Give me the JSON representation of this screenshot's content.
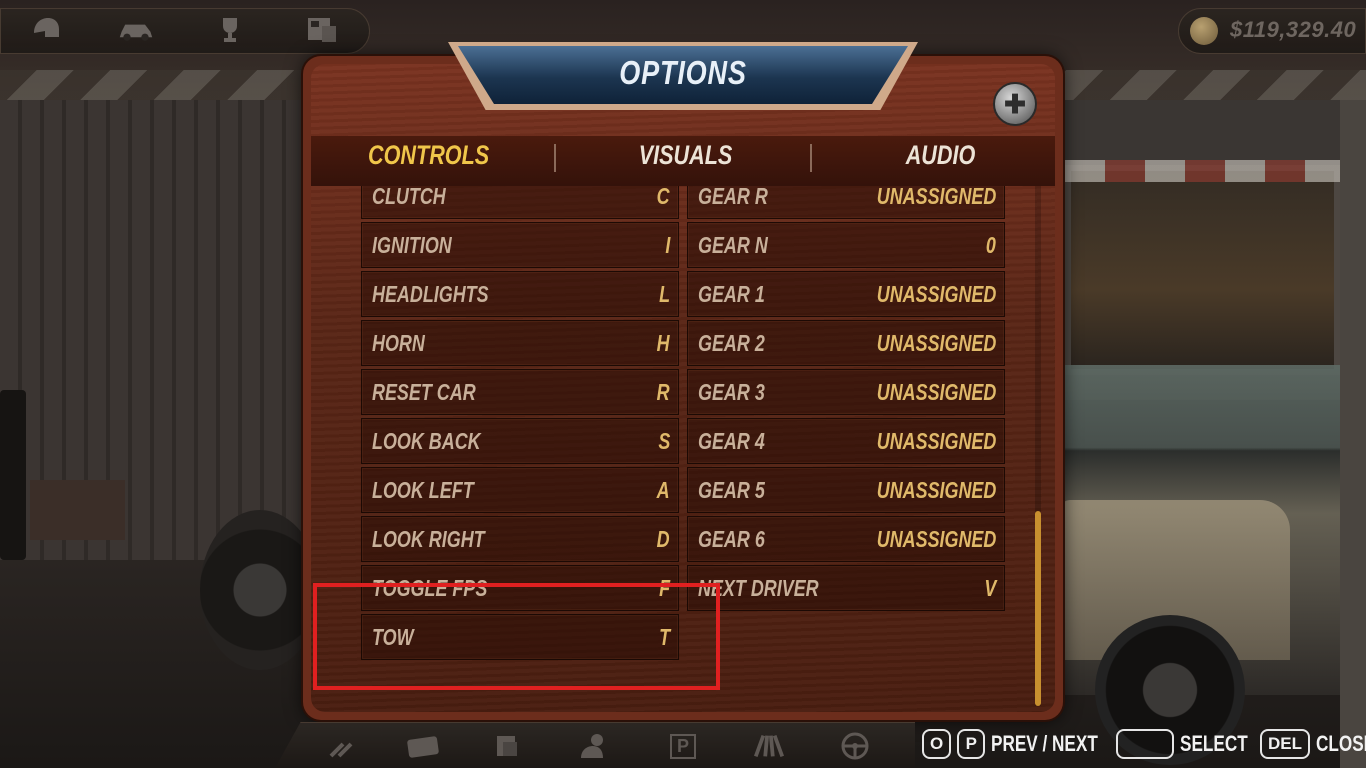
{
  "hud": {
    "money": "$119,329.40",
    "top_icons": [
      "helmet-icon",
      "car-icon",
      "trophy-icon",
      "newspaper-icon"
    ]
  },
  "dialog": {
    "title": "OPTIONS",
    "tabs": [
      {
        "label": "CONTROLS",
        "active": true
      },
      {
        "label": "VISUALS",
        "active": false
      },
      {
        "label": "AUDIO",
        "active": false
      }
    ],
    "left_bindings": [
      {
        "label": "CLUTCH",
        "key": "C"
      },
      {
        "label": "IGNITION",
        "key": "I"
      },
      {
        "label": "HEADLIGHTS",
        "key": "L"
      },
      {
        "label": "HORN",
        "key": "H"
      },
      {
        "label": "RESET CAR",
        "key": "R"
      },
      {
        "label": "LOOK BACK",
        "key": "S"
      },
      {
        "label": "LOOK LEFT",
        "key": "A"
      },
      {
        "label": "LOOK RIGHT",
        "key": "D"
      },
      {
        "label": "TOGGLE FPS",
        "key": "F"
      },
      {
        "label": "TOW",
        "key": "T"
      }
    ],
    "right_bindings": [
      {
        "label": "GEAR R",
        "key": "UNASSIGNED"
      },
      {
        "label": "GEAR N",
        "key": "0"
      },
      {
        "label": "GEAR 1",
        "key": "UNASSIGNED"
      },
      {
        "label": "GEAR 2",
        "key": "UNASSIGNED"
      },
      {
        "label": "GEAR 3",
        "key": "UNASSIGNED"
      },
      {
        "label": "GEAR 4",
        "key": "UNASSIGNED"
      },
      {
        "label": "GEAR 5",
        "key": "UNASSIGNED"
      },
      {
        "label": "GEAR 6",
        "key": "UNASSIGNED"
      },
      {
        "label": "NEXT DRIVER",
        "key": "V"
      }
    ]
  },
  "bottom": {
    "dock_icons": [
      "wrench-icon",
      "card-icon",
      "parts-icon",
      "chat-icon",
      "parking-icon",
      "road-icon",
      "steering-wheel-icon"
    ],
    "parking_glyph": "P",
    "hints": {
      "prev_key": "O",
      "next_key": "P",
      "prev_next_label": "PREV / NEXT",
      "select_label": "SELECT",
      "close_key": "DEL",
      "close_label": "CLOSE"
    }
  },
  "colors": {
    "tab_active": "#f0c64a",
    "key_text": "#e0b96a",
    "panel_wood": "#6c2d1c",
    "highlight": "#e02020"
  }
}
